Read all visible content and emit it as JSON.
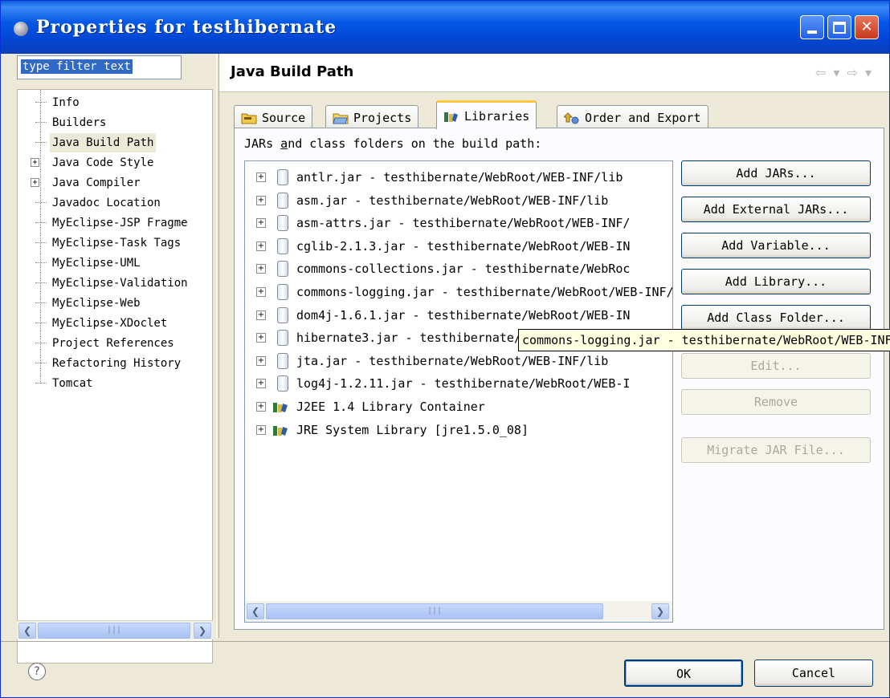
{
  "window": {
    "title": "Properties for testhibernate"
  },
  "filter": {
    "value": "type filter text"
  },
  "tree": {
    "items": [
      {
        "label": "Info",
        "expandable": false,
        "selected": false
      },
      {
        "label": "Builders",
        "expandable": false,
        "selected": false
      },
      {
        "label": "Java Build Path",
        "expandable": false,
        "selected": true
      },
      {
        "label": "Java Code Style",
        "expandable": true,
        "selected": false
      },
      {
        "label": "Java Compiler",
        "expandable": true,
        "selected": false
      },
      {
        "label": "Javadoc Location",
        "expandable": false,
        "selected": false
      },
      {
        "label": "MyEclipse-JSP Fragme",
        "expandable": false,
        "selected": false
      },
      {
        "label": "MyEclipse-Task Tags",
        "expandable": false,
        "selected": false
      },
      {
        "label": "MyEclipse-UML",
        "expandable": false,
        "selected": false
      },
      {
        "label": "MyEclipse-Validation",
        "expandable": false,
        "selected": false
      },
      {
        "label": "MyEclipse-Web",
        "expandable": false,
        "selected": false
      },
      {
        "label": "MyEclipse-XDoclet",
        "expandable": false,
        "selected": false
      },
      {
        "label": "Project References",
        "expandable": false,
        "selected": false
      },
      {
        "label": "Refactoring History",
        "expandable": false,
        "selected": false
      },
      {
        "label": "Tomcat",
        "expandable": false,
        "selected": false
      }
    ]
  },
  "page": {
    "title": "Java Build Path",
    "tabs": [
      {
        "label": "Source",
        "icon": "source-folder-icon",
        "active": false
      },
      {
        "label": "Projects",
        "icon": "projects-folder-icon",
        "active": false
      },
      {
        "label": "Libraries",
        "icon": "libraries-icon",
        "active": true
      },
      {
        "label": "Order and Export",
        "icon": "order-export-icon",
        "active": false
      }
    ],
    "list_caption_pre": "JARs ",
    "list_caption_u": "a",
    "list_caption_post": "nd class folders on the build path:",
    "entries": [
      {
        "text": "antlr.jar - testhibernate/WebRoot/WEB-INF/lib",
        "type": "jar"
      },
      {
        "text": "asm.jar - testhibernate/WebRoot/WEB-INF/lib",
        "type": "jar"
      },
      {
        "text": "asm-attrs.jar - testhibernate/WebRoot/WEB-INF/",
        "type": "jar"
      },
      {
        "text": "cglib-2.1.3.jar - testhibernate/WebRoot/WEB-IN",
        "type": "jar"
      },
      {
        "text": "commons-collections.jar - testhibernate/WebRoc",
        "type": "jar"
      },
      {
        "text": "commons-logging.jar - testhibernate/WebRoot/WEB-INF/lib",
        "type": "jar"
      },
      {
        "text": "dom4j-1.6.1.jar - testhibernate/WebRoot/WEB-IN",
        "type": "jar"
      },
      {
        "text": "hibernate3.jar - testhibernate/WebRoot/WEB-INF",
        "type": "jar"
      },
      {
        "text": "jta.jar - testhibernate/WebRoot/WEB-INF/lib",
        "type": "jar"
      },
      {
        "text": "log4j-1.2.11.jar - testhibernate/WebRoot/WEB-I",
        "type": "jar"
      },
      {
        "text": "J2EE 1.4 Library Container",
        "type": "library"
      },
      {
        "text": "JRE System Library [jre1.5.0_08]",
        "type": "library"
      }
    ],
    "tooltip": "commons-logging.jar - testhibernate/WebRoot/WEB-INF/lib",
    "buttons": [
      {
        "label": "Add JARs...",
        "enabled": true
      },
      {
        "label": "Add External JARs...",
        "enabled": true
      },
      {
        "label": "Add Variable...",
        "enabled": true
      },
      {
        "label": "Add Library...",
        "enabled": true
      },
      {
        "label": "Add Class Folder...",
        "enabled": true
      },
      {
        "label": "Edit...",
        "enabled": false
      },
      {
        "label": "Remove",
        "enabled": false
      },
      {
        "label": "Migrate JAR File...",
        "enabled": false
      }
    ]
  },
  "footer": {
    "ok_label": "OK",
    "cancel_label": "Cancel"
  },
  "colors": {
    "titlebar": "#0559e6",
    "selection": "#316ac5",
    "tooltip_bg": "#ffffe1",
    "active_tab_accent": "#ffc83c"
  }
}
